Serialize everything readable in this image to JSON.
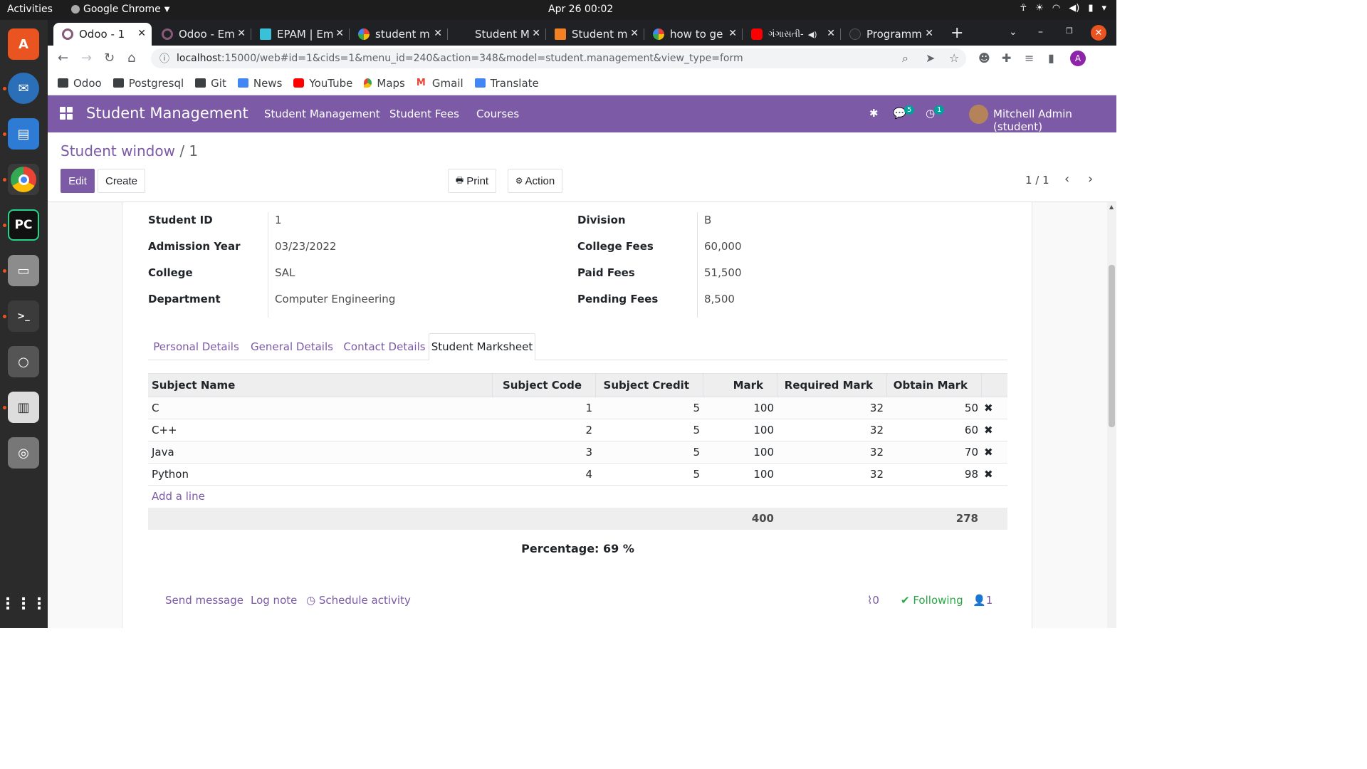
{
  "os": {
    "activities": "Activities",
    "app_name": "Google Chrome",
    "clock": "Apr 26  00:02"
  },
  "browser": {
    "tabs": [
      {
        "label": "Odoo - 1",
        "icon": "odoo-icon",
        "active": true
      },
      {
        "label": "Odoo - Em",
        "icon": "odoo-icon",
        "active": false
      },
      {
        "label": "EPAM | Em",
        "icon": "epam-icon",
        "active": false
      },
      {
        "label": "student m",
        "icon": "google-icon",
        "active": false
      },
      {
        "label": "Student M",
        "icon": "blank-icon",
        "active": false
      },
      {
        "label": "Student m",
        "icon": "stackoverflow-icon",
        "active": false
      },
      {
        "label": "how to ge",
        "icon": "google-icon",
        "active": false
      },
      {
        "label": "ગંગાસતી-",
        "icon": "youtube-icon",
        "active": false
      },
      {
        "label": "Programm",
        "icon": "github-icon",
        "active": false
      }
    ],
    "url_host": "localhost",
    "url_path": ":15000/web#id=1&cids=1&menu_id=240&action=348&model=student.management&view_type=form",
    "profile_initial": "A",
    "bookmarks": [
      {
        "label": "Odoo",
        "icon": "folder-icon"
      },
      {
        "label": "Postgresql",
        "icon": "folder-icon"
      },
      {
        "label": "Git",
        "icon": "folder-icon"
      },
      {
        "label": "News",
        "icon": "news-icon"
      },
      {
        "label": "YouTube",
        "icon": "youtube-icon"
      },
      {
        "label": "Maps",
        "icon": "maps-icon"
      },
      {
        "label": "Gmail",
        "icon": "gmail-icon"
      },
      {
        "label": "Translate",
        "icon": "translate-icon"
      }
    ]
  },
  "odoo": {
    "brand": "Student Management",
    "menus": [
      "Student Management",
      "Student Fees",
      "Courses"
    ],
    "messages_badge": "5",
    "activities_badge": "1",
    "user": "Mitchell Admin (student)",
    "accent": "#7c5aa6"
  },
  "control": {
    "breadcrumb_parent": "Student window",
    "breadcrumb_sep": " / ",
    "breadcrumb_current": "1",
    "edit": "Edit",
    "create": "Create",
    "print": "Print",
    "action": "Action",
    "pager": "1 / 1"
  },
  "form": {
    "left_fields": [
      {
        "label": "Student ID",
        "value": "1"
      },
      {
        "label": "Admission Year",
        "value": "03/23/2022"
      },
      {
        "label": "College",
        "value": "SAL"
      },
      {
        "label": "Department",
        "value": "Computer Engineering"
      }
    ],
    "right_fields": [
      {
        "label": "Division",
        "value": "B"
      },
      {
        "label": "College Fees",
        "value": "60,000"
      },
      {
        "label": "Paid Fees",
        "value": "51,500"
      },
      {
        "label": "Pending Fees",
        "value": "8,500"
      }
    ],
    "tabs": [
      "Personal Details",
      "General Details",
      "Contact Details",
      "Student Marksheet"
    ],
    "active_tab": "Student Marksheet"
  },
  "marksheet": {
    "columns": [
      "Subject Name",
      "Subject Code",
      "Subject Credit",
      "Mark",
      "Required Mark",
      "Obtain Mark"
    ],
    "rows": [
      {
        "subject": "C",
        "code": "1",
        "credit": "5",
        "mark": "100",
        "required": "32",
        "obtain": "50"
      },
      {
        "subject": "C++",
        "code": "2",
        "credit": "5",
        "mark": "100",
        "required": "32",
        "obtain": "60"
      },
      {
        "subject": "Java",
        "code": "3",
        "credit": "5",
        "mark": "100",
        "required": "32",
        "obtain": "70"
      },
      {
        "subject": "Python",
        "code": "4",
        "credit": "5",
        "mark": "100",
        "required": "32",
        "obtain": "98"
      }
    ],
    "add_line": "Add a line",
    "total_mark": "400",
    "total_obtain": "278",
    "percentage": "Percentage: 69 %"
  },
  "chatter": {
    "send_message": "Send message",
    "log_note": "Log note",
    "schedule_activity": "Schedule activity",
    "attachments": "0",
    "following": "Following",
    "followers": "1"
  }
}
